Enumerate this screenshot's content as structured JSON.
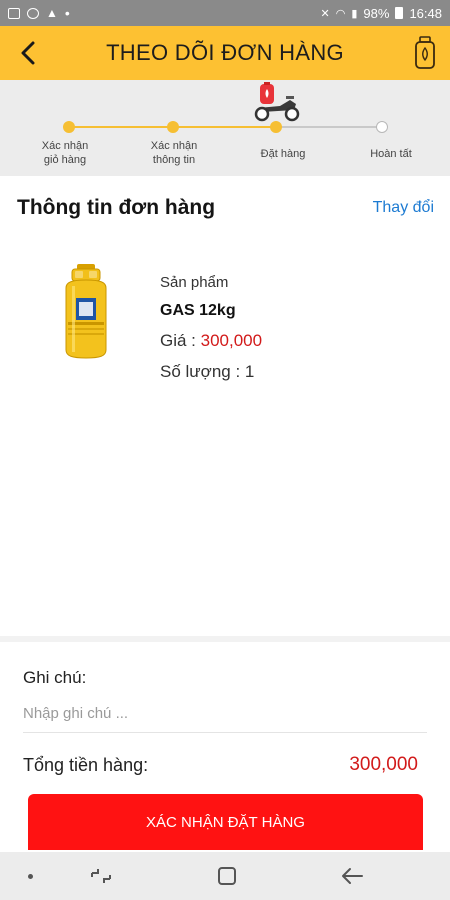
{
  "status_bar": {
    "battery_pct": "98%",
    "time": "16:48"
  },
  "header": {
    "title": "THEO DÕI ĐƠN HÀNG"
  },
  "stepper": {
    "steps": [
      {
        "label_line1": "Xác nhận",
        "label_line2": "giỏ hàng",
        "state": "done"
      },
      {
        "label_line1": "Xác nhận",
        "label_line2": "thông tin",
        "state": "done"
      },
      {
        "label_line1": "Đặt hàng",
        "label_line2": "",
        "state": "current"
      },
      {
        "label_line1": "Hoàn tất",
        "label_line2": "",
        "state": "todo"
      }
    ],
    "accent_color": "#f6bf33"
  },
  "order": {
    "section_title": "Thông tin đơn hàng",
    "change_label": "Thay đổi",
    "product": {
      "label": "Sản phẩm",
      "name": "GAS 12kg",
      "price_label": "Giá : ",
      "price_value": "300,000",
      "qty_text": "Số lượng : 1"
    }
  },
  "footer": {
    "note_label": "Ghi chú:",
    "note_placeholder": "Nhập ghi chú ...",
    "note_value": "",
    "total_label": "Tổng tiền hàng:",
    "total_value": "300,000",
    "confirm_label": "XÁC NHẬN ĐẶT HÀNG",
    "confirm_color": "#ff1212"
  },
  "colors": {
    "header_bg": "#fdc132",
    "price_red": "#d21a1a",
    "link_blue": "#1d7bd2"
  },
  "nav_bar": {
    "icons": [
      "dot-icon",
      "recent-apps-icon",
      "home-icon",
      "back-icon"
    ]
  }
}
